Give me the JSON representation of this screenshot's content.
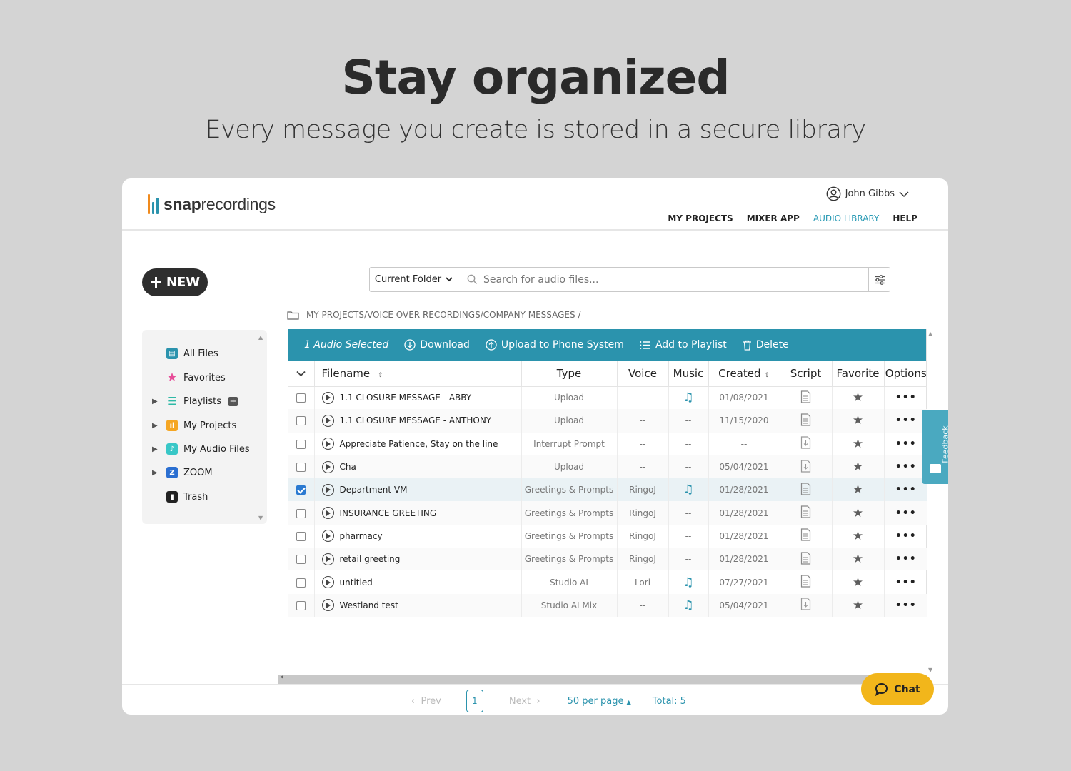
{
  "hero": {
    "title": "Stay organized",
    "subtitle": "Every message you create is stored in a secure library"
  },
  "brand": {
    "name_bold": "snap",
    "name_rest": "recordings",
    "bar_colors": [
      "#f08a1d",
      "#2b93ad",
      "#2b93ad"
    ]
  },
  "user": {
    "name": "John Gibbs"
  },
  "nav": {
    "items": [
      "MY PROJECTS",
      "MIXER APP",
      "AUDIO LIBRARY",
      "HELP"
    ],
    "active": "AUDIO LIBRARY"
  },
  "new_button": {
    "label": "NEW"
  },
  "search": {
    "scope": "Current Folder",
    "placeholder": "Search for audio files..."
  },
  "breadcrumb": {
    "path": "MY PROJECTS/VOICE OVER RECORDINGS/COMPANY MESSAGES /"
  },
  "sidebar": {
    "items": [
      {
        "label": "All Files",
        "icon": "archive-icon",
        "color": "#2b93ad",
        "expandable": false
      },
      {
        "label": "Favorites",
        "icon": "star-icon",
        "color": "#e74c98",
        "expandable": false
      },
      {
        "label": "Playlists",
        "icon": "list-icon",
        "color": "#2eb9a6",
        "expandable": true
      },
      {
        "label": "My Projects",
        "icon": "project-icon",
        "color": "#f5a623",
        "expandable": true
      },
      {
        "label": "My Audio Files",
        "icon": "audio-file-icon",
        "color": "#38c7c7",
        "expandable": true
      },
      {
        "label": "ZOOM",
        "icon": "zoom-icon",
        "color": "#2b6fd1",
        "expandable": true
      },
      {
        "label": "Trash",
        "icon": "trash-icon",
        "color": "#222222",
        "expandable": false
      }
    ]
  },
  "toolbar": {
    "selected": "1 Audio Selected",
    "download": "Download",
    "upload": "Upload to Phone System",
    "playlist": "Add to Playlist",
    "delete": "Delete"
  },
  "table": {
    "headers": {
      "filename": "Filename",
      "type": "Type",
      "voice": "Voice",
      "music": "Music",
      "created": "Created",
      "script": "Script",
      "favorite": "Favorite",
      "options": "Options"
    },
    "rows": [
      {
        "filename": "1.1 CLOSURE MESSAGE - ABBY",
        "type": "Upload",
        "voice": "--",
        "music": true,
        "created": "01/08/2021",
        "script": "text",
        "checked": false
      },
      {
        "filename": "1.1 CLOSURE MESSAGE - ANTHONY",
        "type": "Upload",
        "voice": "--",
        "music": false,
        "created": "11/15/2020",
        "script": "text",
        "checked": false
      },
      {
        "filename": "Appreciate Patience, Stay on the line",
        "type": "Interrupt Prompt",
        "voice": "--",
        "music": false,
        "created": "--",
        "script": "download",
        "checked": false
      },
      {
        "filename": "Cha",
        "type": "Upload",
        "voice": "--",
        "music": false,
        "created": "05/04/2021",
        "script": "download",
        "checked": false
      },
      {
        "filename": "Department VM",
        "type": "Greetings & Prompts",
        "voice": "RingoJ",
        "music": true,
        "created": "01/28/2021",
        "script": "text",
        "checked": true
      },
      {
        "filename": "INSURANCE GREETING",
        "type": "Greetings & Prompts",
        "voice": "RingoJ",
        "music": false,
        "created": "01/28/2021",
        "script": "text",
        "checked": false
      },
      {
        "filename": "pharmacy",
        "type": "Greetings & Prompts",
        "voice": "RingoJ",
        "music": false,
        "created": "01/28/2021",
        "script": "text",
        "checked": false
      },
      {
        "filename": "retail greeting",
        "type": "Greetings & Prompts",
        "voice": "RingoJ",
        "music": false,
        "created": "01/28/2021",
        "script": "text",
        "checked": false
      },
      {
        "filename": "untitled",
        "type": "Studio AI",
        "voice": "Lori",
        "music": true,
        "created": "07/27/2021",
        "script": "text",
        "checked": false
      },
      {
        "filename": "Westland test",
        "type": "Studio AI Mix",
        "voice": "--",
        "music": true,
        "created": "05/04/2021",
        "script": "download",
        "checked": false
      }
    ],
    "no_music": "--",
    "options_glyph": "•••"
  },
  "pagination": {
    "prev": "Prev",
    "page": "1",
    "next": "Next",
    "per_page": "50 per page",
    "total": "Total:  5"
  },
  "chat": {
    "label": "Chat"
  },
  "feedback": {
    "label": "Feedback"
  },
  "colors": {
    "accent": "#2b93ad",
    "chat": "#f2b61b",
    "dark": "#2e2e2e"
  }
}
